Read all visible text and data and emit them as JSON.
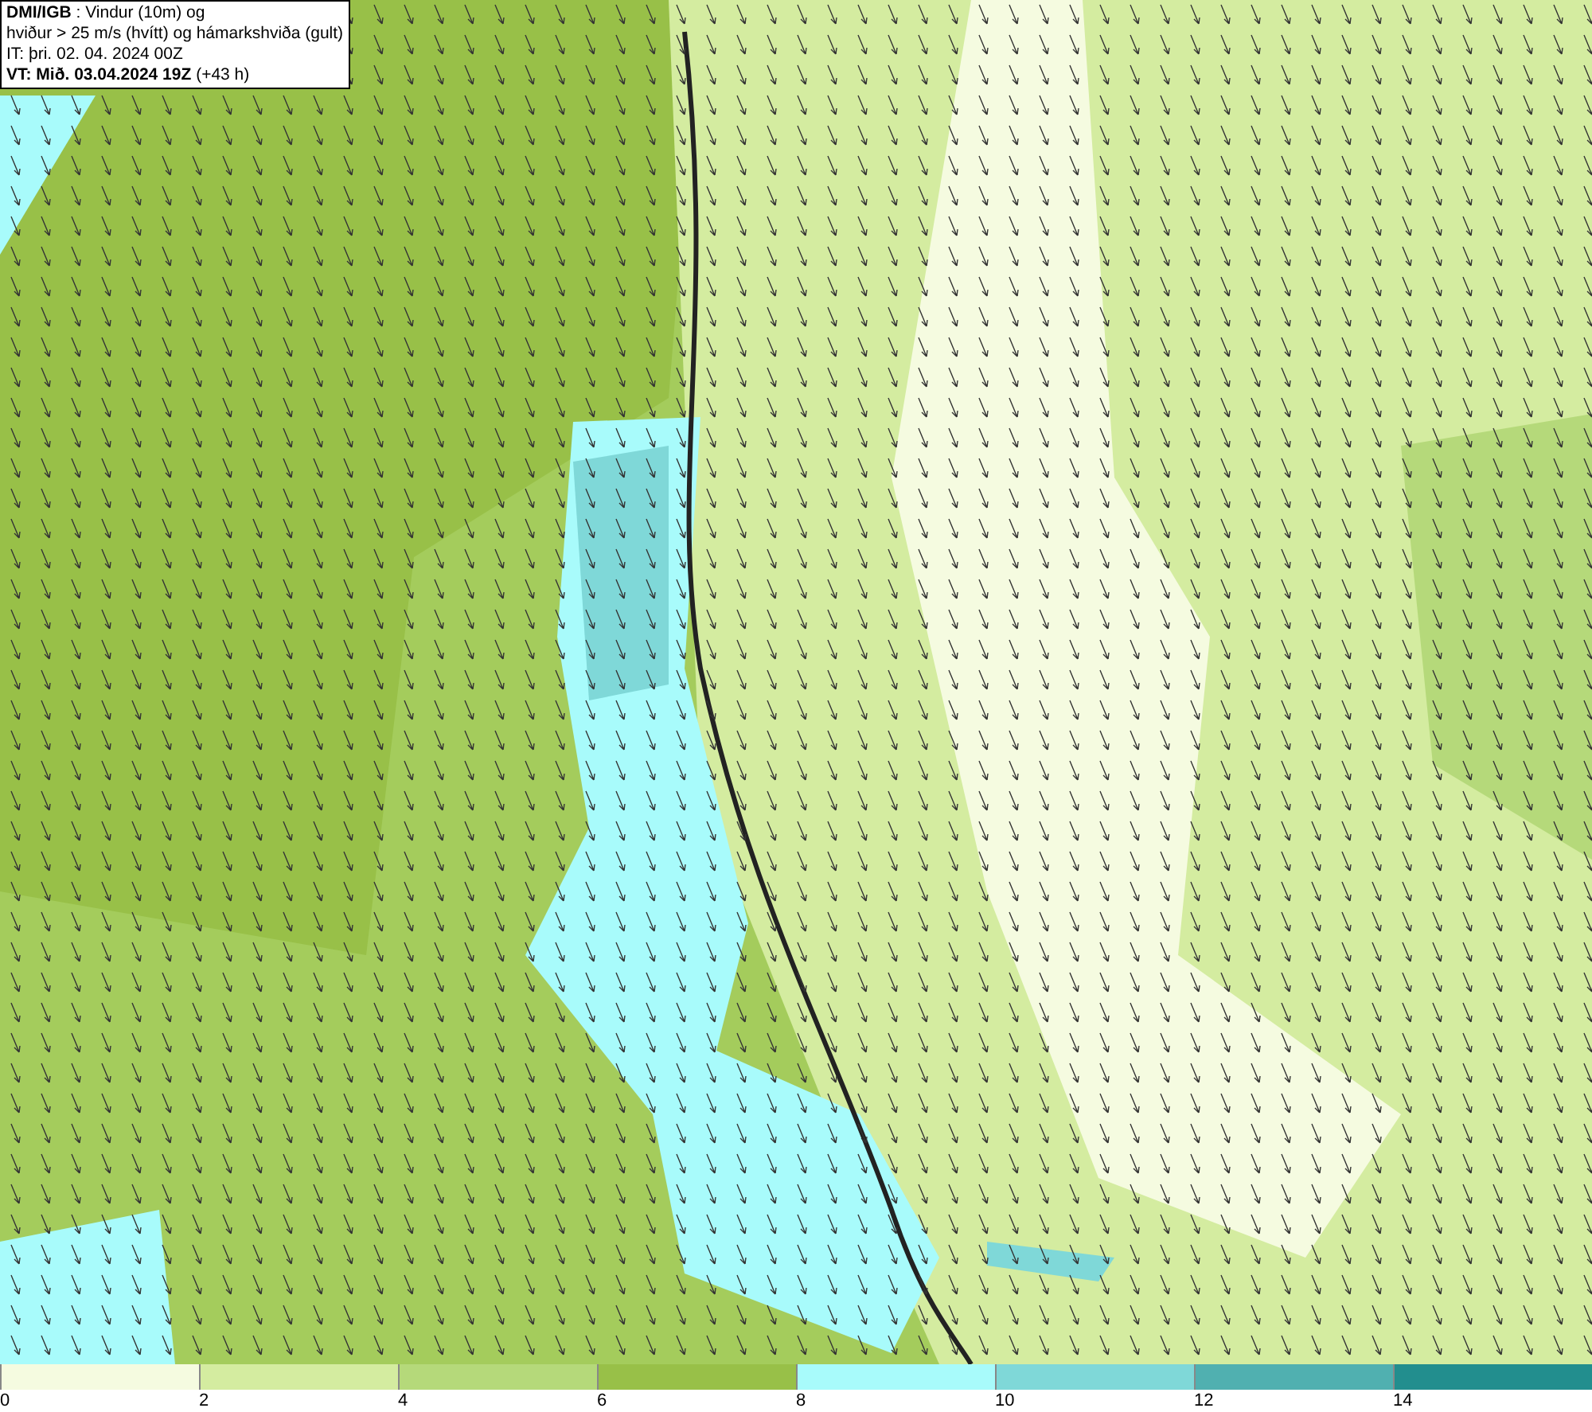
{
  "title_box": {
    "lines": [
      "**DMI/IGB** : Vindur (10m) og",
      "hviður > 25 m/s (hvítt) og hámarkshviða (gult)",
      "IT: þri. 02. 04. 2024 00Z",
      "**VT: Mið. 03.04.2024 19Z** (+43 h)"
    ]
  },
  "legend": {
    "bins": [
      {
        "color": "#f5fbe0",
        "label": "0"
      },
      {
        "color": "#d4eca0",
        "label": "2"
      },
      {
        "color": "#b5d97a",
        "label": "4"
      },
      {
        "color": "#98c048",
        "label": "6"
      },
      {
        "color": "#a8fbfb",
        "label": "8"
      },
      {
        "color": "#7fd8d8",
        "label": "10"
      },
      {
        "color": "#50b0b0",
        "label": "12"
      },
      {
        "color": "#228e8e",
        "label": "14"
      }
    ]
  }
}
